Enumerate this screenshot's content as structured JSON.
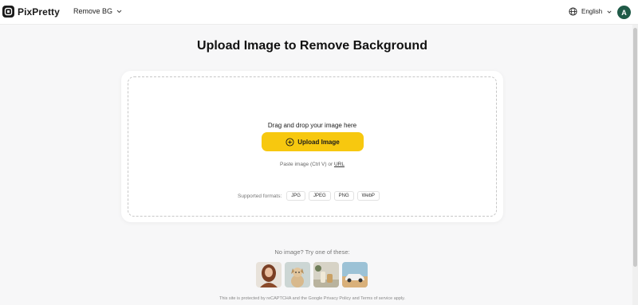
{
  "header": {
    "brand": "PixPretty",
    "tool_menu": "Remove BG",
    "language": "English",
    "avatar_initial": "A"
  },
  "main": {
    "title": "Upload Image to Remove Background",
    "drop_text": "Drag and drop your image here",
    "upload_button": "Upload Image",
    "paste_text": "Paste image (Ctrl V) or",
    "paste_url_link": "URL",
    "formats_label": "Supported formats:",
    "formats": [
      "JPG",
      "JPEG",
      "PNG",
      "WebP"
    ]
  },
  "samples": {
    "label": "No image? Try one of these:",
    "images": [
      "sample-woman",
      "sample-dog",
      "sample-product",
      "sample-car"
    ]
  },
  "footer": {
    "note": "This site is protected by reCAPTCHA and the Google Privacy Policy and Terms of service apply."
  },
  "colors": {
    "accent": "#f7c80f",
    "avatar": "#1f5a47",
    "background": "#f7f7f8"
  }
}
